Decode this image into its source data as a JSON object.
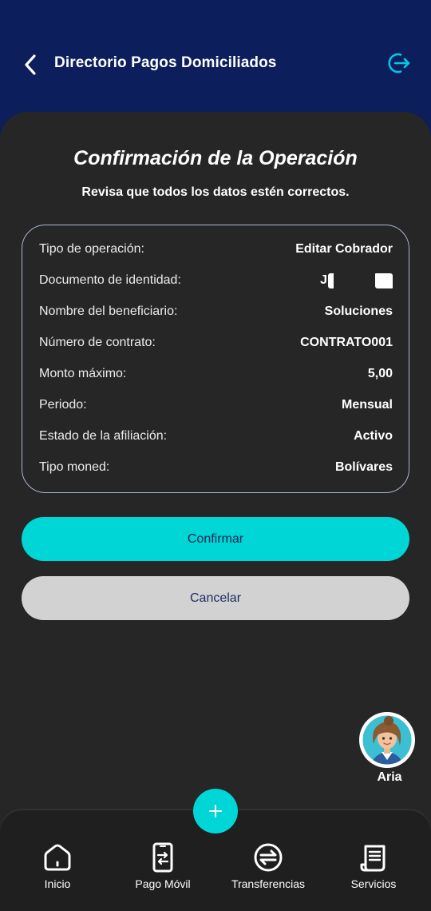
{
  "header": {
    "title": "Directorio Pagos Domiciliados"
  },
  "confirmation": {
    "title": "Confirmación de la Operación",
    "subtitle": "Revisa que todos los datos estén correctos."
  },
  "details": [
    {
      "label": "Tipo de operación:",
      "value": "Editar Cobrador"
    },
    {
      "label": "Documento de identidad:",
      "value": "J"
    },
    {
      "label": "Nombre del beneficiario:",
      "value": "Soluciones"
    },
    {
      "label": "Número de contrato:",
      "value": "CONTRATO001"
    },
    {
      "label": "Monto máximo:",
      "value": "5,00"
    },
    {
      "label": "Periodo:",
      "value": "Mensual"
    },
    {
      "label": "Estado de la afiliación:",
      "value": "Activo"
    },
    {
      "label": "Tipo moned:",
      "value": "Bolívares"
    }
  ],
  "actions": {
    "confirm_label": "Confirmar",
    "cancel_label": "Cancelar"
  },
  "assistant": {
    "name": "Aria",
    "icon": "avatar-icon"
  },
  "nav": {
    "fab_icon": "plus-icon",
    "items": [
      {
        "label": "Inicio",
        "icon": "home-icon"
      },
      {
        "label": "Pago Móvil",
        "icon": "phone-transfer-icon"
      },
      {
        "label": "Transferencias",
        "icon": "exchange-icon"
      },
      {
        "label": "Servicios",
        "icon": "receipt-icon"
      }
    ]
  },
  "colors": {
    "header_bg": "#0c1e5b",
    "sheet_bg": "#262626",
    "accent": "#00d6d5",
    "cancel_bg": "#d2d2d2",
    "nav_bg": "#1f1f1f"
  }
}
